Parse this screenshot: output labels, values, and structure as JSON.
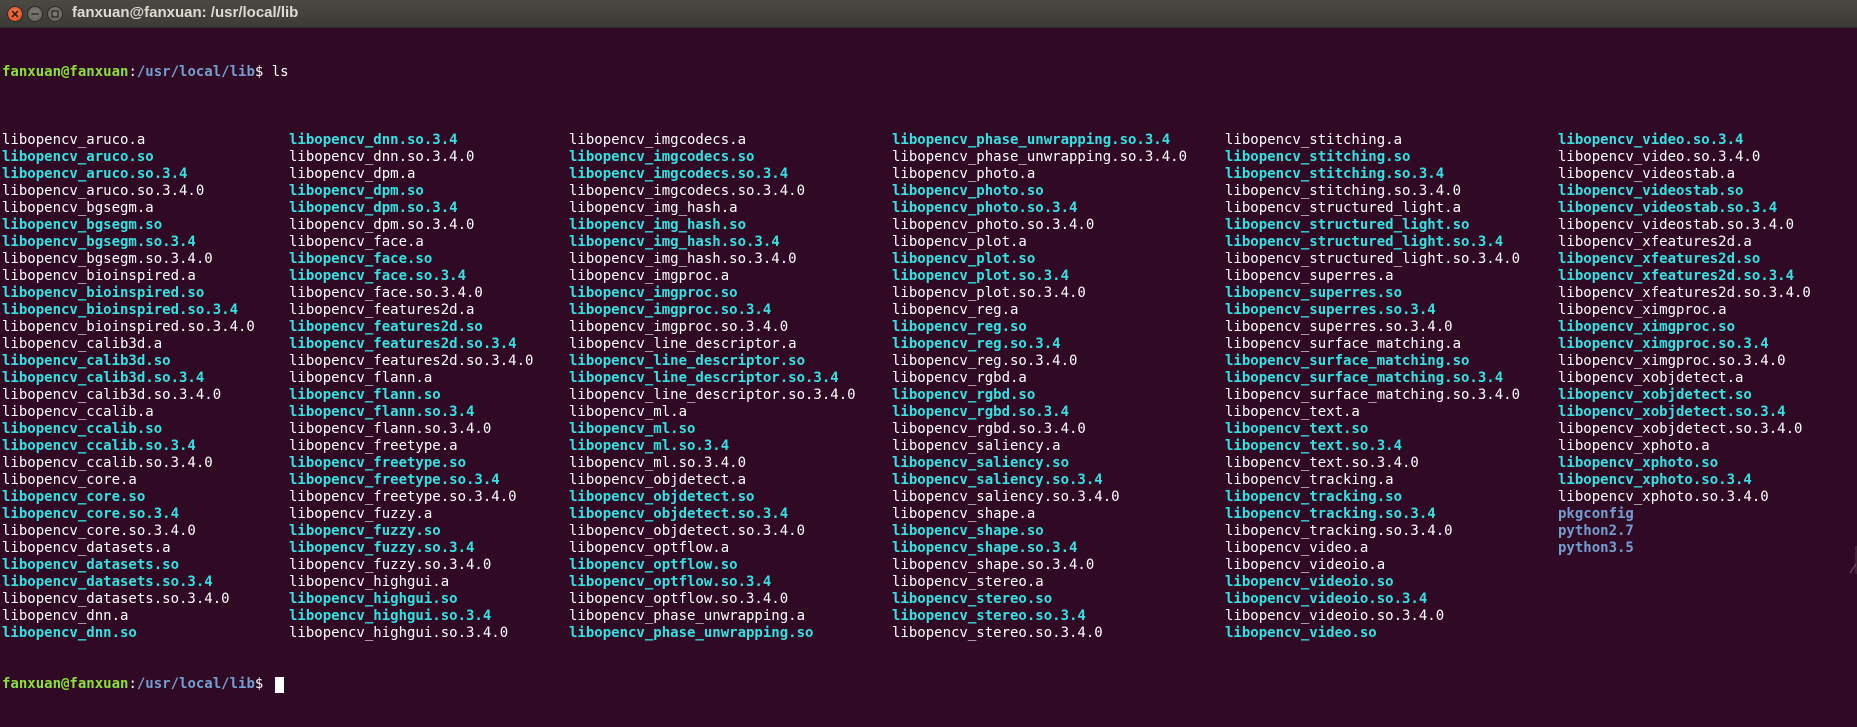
{
  "window": {
    "title": "fanxuan@fanxuan: /usr/local/lib"
  },
  "prompt": {
    "user_host": "fanxuan@fanxuan",
    "colon": ":",
    "path": "/usr/local/lib",
    "dollar": "$ "
  },
  "command": "ls",
  "colors": {
    "background": "#300a24",
    "file": "#ffffff",
    "symlink": "#34e2e2",
    "directory": "#729fcf",
    "prompt_user": "#8ae234"
  },
  "listing": [
    [
      {
        "name": "libopencv_aruco.a",
        "type": "file"
      },
      {
        "name": "libopencv_aruco.so",
        "type": "link"
      },
      {
        "name": "libopencv_aruco.so.3.4",
        "type": "link"
      },
      {
        "name": "libopencv_aruco.so.3.4.0",
        "type": "file"
      },
      {
        "name": "libopencv_bgsegm.a",
        "type": "file"
      },
      {
        "name": "libopencv_bgsegm.so",
        "type": "link"
      },
      {
        "name": "libopencv_bgsegm.so.3.4",
        "type": "link"
      },
      {
        "name": "libopencv_bgsegm.so.3.4.0",
        "type": "file"
      },
      {
        "name": "libopencv_bioinspired.a",
        "type": "file"
      },
      {
        "name": "libopencv_bioinspired.so",
        "type": "link"
      },
      {
        "name": "libopencv_bioinspired.so.3.4",
        "type": "link"
      },
      {
        "name": "libopencv_bioinspired.so.3.4.0",
        "type": "file"
      },
      {
        "name": "libopencv_calib3d.a",
        "type": "file"
      },
      {
        "name": "libopencv_calib3d.so",
        "type": "link"
      },
      {
        "name": "libopencv_calib3d.so.3.4",
        "type": "link"
      },
      {
        "name": "libopencv_calib3d.so.3.4.0",
        "type": "file"
      },
      {
        "name": "libopencv_ccalib.a",
        "type": "file"
      },
      {
        "name": "libopencv_ccalib.so",
        "type": "link"
      },
      {
        "name": "libopencv_ccalib.so.3.4",
        "type": "link"
      },
      {
        "name": "libopencv_ccalib.so.3.4.0",
        "type": "file"
      },
      {
        "name": "libopencv_core.a",
        "type": "file"
      },
      {
        "name": "libopencv_core.so",
        "type": "link"
      },
      {
        "name": "libopencv_core.so.3.4",
        "type": "link"
      },
      {
        "name": "libopencv_core.so.3.4.0",
        "type": "file"
      },
      {
        "name": "libopencv_datasets.a",
        "type": "file"
      },
      {
        "name": "libopencv_datasets.so",
        "type": "link"
      },
      {
        "name": "libopencv_datasets.so.3.4",
        "type": "link"
      },
      {
        "name": "libopencv_datasets.so.3.4.0",
        "type": "file"
      },
      {
        "name": "libopencv_dnn.a",
        "type": "file"
      },
      {
        "name": "libopencv_dnn.so",
        "type": "link"
      }
    ],
    [
      {
        "name": "libopencv_dnn.so.3.4",
        "type": "link"
      },
      {
        "name": "libopencv_dnn.so.3.4.0",
        "type": "file"
      },
      {
        "name": "libopencv_dpm.a",
        "type": "file"
      },
      {
        "name": "libopencv_dpm.so",
        "type": "link"
      },
      {
        "name": "libopencv_dpm.so.3.4",
        "type": "link"
      },
      {
        "name": "libopencv_dpm.so.3.4.0",
        "type": "file"
      },
      {
        "name": "libopencv_face.a",
        "type": "file"
      },
      {
        "name": "libopencv_face.so",
        "type": "link"
      },
      {
        "name": "libopencv_face.so.3.4",
        "type": "link"
      },
      {
        "name": "libopencv_face.so.3.4.0",
        "type": "file"
      },
      {
        "name": "libopencv_features2d.a",
        "type": "file"
      },
      {
        "name": "libopencv_features2d.so",
        "type": "link"
      },
      {
        "name": "libopencv_features2d.so.3.4",
        "type": "link"
      },
      {
        "name": "libopencv_features2d.so.3.4.0",
        "type": "file"
      },
      {
        "name": "libopencv_flann.a",
        "type": "file"
      },
      {
        "name": "libopencv_flann.so",
        "type": "link"
      },
      {
        "name": "libopencv_flann.so.3.4",
        "type": "link"
      },
      {
        "name": "libopencv_flann.so.3.4.0",
        "type": "file"
      },
      {
        "name": "libopencv_freetype.a",
        "type": "file"
      },
      {
        "name": "libopencv_freetype.so",
        "type": "link"
      },
      {
        "name": "libopencv_freetype.so.3.4",
        "type": "link"
      },
      {
        "name": "libopencv_freetype.so.3.4.0",
        "type": "file"
      },
      {
        "name": "libopencv_fuzzy.a",
        "type": "file"
      },
      {
        "name": "libopencv_fuzzy.so",
        "type": "link"
      },
      {
        "name": "libopencv_fuzzy.so.3.4",
        "type": "link"
      },
      {
        "name": "libopencv_fuzzy.so.3.4.0",
        "type": "file"
      },
      {
        "name": "libopencv_highgui.a",
        "type": "file"
      },
      {
        "name": "libopencv_highgui.so",
        "type": "link"
      },
      {
        "name": "libopencv_highgui.so.3.4",
        "type": "link"
      },
      {
        "name": "libopencv_highgui.so.3.4.0",
        "type": "file"
      }
    ],
    [
      {
        "name": "libopencv_imgcodecs.a",
        "type": "file"
      },
      {
        "name": "libopencv_imgcodecs.so",
        "type": "link"
      },
      {
        "name": "libopencv_imgcodecs.so.3.4",
        "type": "link"
      },
      {
        "name": "libopencv_imgcodecs.so.3.4.0",
        "type": "file"
      },
      {
        "name": "libopencv_img_hash.a",
        "type": "file"
      },
      {
        "name": "libopencv_img_hash.so",
        "type": "link"
      },
      {
        "name": "libopencv_img_hash.so.3.4",
        "type": "link"
      },
      {
        "name": "libopencv_img_hash.so.3.4.0",
        "type": "file"
      },
      {
        "name": "libopencv_imgproc.a",
        "type": "file"
      },
      {
        "name": "libopencv_imgproc.so",
        "type": "link"
      },
      {
        "name": "libopencv_imgproc.so.3.4",
        "type": "link"
      },
      {
        "name": "libopencv_imgproc.so.3.4.0",
        "type": "file"
      },
      {
        "name": "libopencv_line_descriptor.a",
        "type": "file"
      },
      {
        "name": "libopencv_line_descriptor.so",
        "type": "link"
      },
      {
        "name": "libopencv_line_descriptor.so.3.4",
        "type": "link"
      },
      {
        "name": "libopencv_line_descriptor.so.3.4.0",
        "type": "file"
      },
      {
        "name": "libopencv_ml.a",
        "type": "file"
      },
      {
        "name": "libopencv_ml.so",
        "type": "link"
      },
      {
        "name": "libopencv_ml.so.3.4",
        "type": "link"
      },
      {
        "name": "libopencv_ml.so.3.4.0",
        "type": "file"
      },
      {
        "name": "libopencv_objdetect.a",
        "type": "file"
      },
      {
        "name": "libopencv_objdetect.so",
        "type": "link"
      },
      {
        "name": "libopencv_objdetect.so.3.4",
        "type": "link"
      },
      {
        "name": "libopencv_objdetect.so.3.4.0",
        "type": "file"
      },
      {
        "name": "libopencv_optflow.a",
        "type": "file"
      },
      {
        "name": "libopencv_optflow.so",
        "type": "link"
      },
      {
        "name": "libopencv_optflow.so.3.4",
        "type": "link"
      },
      {
        "name": "libopencv_optflow.so.3.4.0",
        "type": "file"
      },
      {
        "name": "libopencv_phase_unwrapping.a",
        "type": "file"
      },
      {
        "name": "libopencv_phase_unwrapping.so",
        "type": "link"
      }
    ],
    [
      {
        "name": "libopencv_phase_unwrapping.so.3.4",
        "type": "link"
      },
      {
        "name": "libopencv_phase_unwrapping.so.3.4.0",
        "type": "file"
      },
      {
        "name": "libopencv_photo.a",
        "type": "file"
      },
      {
        "name": "libopencv_photo.so",
        "type": "link"
      },
      {
        "name": "libopencv_photo.so.3.4",
        "type": "link"
      },
      {
        "name": "libopencv_photo.so.3.4.0",
        "type": "file"
      },
      {
        "name": "libopencv_plot.a",
        "type": "file"
      },
      {
        "name": "libopencv_plot.so",
        "type": "link"
      },
      {
        "name": "libopencv_plot.so.3.4",
        "type": "link"
      },
      {
        "name": "libopencv_plot.so.3.4.0",
        "type": "file"
      },
      {
        "name": "libopencv_reg.a",
        "type": "file"
      },
      {
        "name": "libopencv_reg.so",
        "type": "link"
      },
      {
        "name": "libopencv_reg.so.3.4",
        "type": "link"
      },
      {
        "name": "libopencv_reg.so.3.4.0",
        "type": "file"
      },
      {
        "name": "libopencv_rgbd.a",
        "type": "file"
      },
      {
        "name": "libopencv_rgbd.so",
        "type": "link"
      },
      {
        "name": "libopencv_rgbd.so.3.4",
        "type": "link"
      },
      {
        "name": "libopencv_rgbd.so.3.4.0",
        "type": "file"
      },
      {
        "name": "libopencv_saliency.a",
        "type": "file"
      },
      {
        "name": "libopencv_saliency.so",
        "type": "link"
      },
      {
        "name": "libopencv_saliency.so.3.4",
        "type": "link"
      },
      {
        "name": "libopencv_saliency.so.3.4.0",
        "type": "file"
      },
      {
        "name": "libopencv_shape.a",
        "type": "file"
      },
      {
        "name": "libopencv_shape.so",
        "type": "link"
      },
      {
        "name": "libopencv_shape.so.3.4",
        "type": "link"
      },
      {
        "name": "libopencv_shape.so.3.4.0",
        "type": "file"
      },
      {
        "name": "libopencv_stereo.a",
        "type": "file"
      },
      {
        "name": "libopencv_stereo.so",
        "type": "link"
      },
      {
        "name": "libopencv_stereo.so.3.4",
        "type": "link"
      },
      {
        "name": "libopencv_stereo.so.3.4.0",
        "type": "file"
      }
    ],
    [
      {
        "name": "libopencv_stitching.a",
        "type": "file"
      },
      {
        "name": "libopencv_stitching.so",
        "type": "link"
      },
      {
        "name": "libopencv_stitching.so.3.4",
        "type": "link"
      },
      {
        "name": "libopencv_stitching.so.3.4.0",
        "type": "file"
      },
      {
        "name": "libopencv_structured_light.a",
        "type": "file"
      },
      {
        "name": "libopencv_structured_light.so",
        "type": "link"
      },
      {
        "name": "libopencv_structured_light.so.3.4",
        "type": "link"
      },
      {
        "name": "libopencv_structured_light.so.3.4.0",
        "type": "file"
      },
      {
        "name": "libopencv_superres.a",
        "type": "file"
      },
      {
        "name": "libopencv_superres.so",
        "type": "link"
      },
      {
        "name": "libopencv_superres.so.3.4",
        "type": "link"
      },
      {
        "name": "libopencv_superres.so.3.4.0",
        "type": "file"
      },
      {
        "name": "libopencv_surface_matching.a",
        "type": "file"
      },
      {
        "name": "libopencv_surface_matching.so",
        "type": "link"
      },
      {
        "name": "libopencv_surface_matching.so.3.4",
        "type": "link"
      },
      {
        "name": "libopencv_surface_matching.so.3.4.0",
        "type": "file"
      },
      {
        "name": "libopencv_text.a",
        "type": "file"
      },
      {
        "name": "libopencv_text.so",
        "type": "link"
      },
      {
        "name": "libopencv_text.so.3.4",
        "type": "link"
      },
      {
        "name": "libopencv_text.so.3.4.0",
        "type": "file"
      },
      {
        "name": "libopencv_tracking.a",
        "type": "file"
      },
      {
        "name": "libopencv_tracking.so",
        "type": "link"
      },
      {
        "name": "libopencv_tracking.so.3.4",
        "type": "link"
      },
      {
        "name": "libopencv_tracking.so.3.4.0",
        "type": "file"
      },
      {
        "name": "libopencv_video.a",
        "type": "file"
      },
      {
        "name": "libopencv_videoio.a",
        "type": "file"
      },
      {
        "name": "libopencv_videoio.so",
        "type": "link"
      },
      {
        "name": "libopencv_videoio.so.3.4",
        "type": "link"
      },
      {
        "name": "libopencv_videoio.so.3.4.0",
        "type": "file"
      },
      {
        "name": "libopencv_video.so",
        "type": "link"
      }
    ],
    [
      {
        "name": "libopencv_video.so.3.4",
        "type": "link"
      },
      {
        "name": "libopencv_video.so.3.4.0",
        "type": "file"
      },
      {
        "name": "libopencv_videostab.a",
        "type": "file"
      },
      {
        "name": "libopencv_videostab.so",
        "type": "link"
      },
      {
        "name": "libopencv_videostab.so.3.4",
        "type": "link"
      },
      {
        "name": "libopencv_videostab.so.3.4.0",
        "type": "file"
      },
      {
        "name": "libopencv_xfeatures2d.a",
        "type": "file"
      },
      {
        "name": "libopencv_xfeatures2d.so",
        "type": "link"
      },
      {
        "name": "libopencv_xfeatures2d.so.3.4",
        "type": "link"
      },
      {
        "name": "libopencv_xfeatures2d.so.3.4.0",
        "type": "file"
      },
      {
        "name": "libopencv_ximgproc.a",
        "type": "file"
      },
      {
        "name": "libopencv_ximgproc.so",
        "type": "link"
      },
      {
        "name": "libopencv_ximgproc.so.3.4",
        "type": "link"
      },
      {
        "name": "libopencv_ximgproc.so.3.4.0",
        "type": "file"
      },
      {
        "name": "libopencv_xobjdetect.a",
        "type": "file"
      },
      {
        "name": "libopencv_xobjdetect.so",
        "type": "link"
      },
      {
        "name": "libopencv_xobjdetect.so.3.4",
        "type": "link"
      },
      {
        "name": "libopencv_xobjdetect.so.3.4.0",
        "type": "file"
      },
      {
        "name": "libopencv_xphoto.a",
        "type": "file"
      },
      {
        "name": "libopencv_xphoto.so",
        "type": "link"
      },
      {
        "name": "libopencv_xphoto.so.3.4",
        "type": "link"
      },
      {
        "name": "libopencv_xphoto.so.3.4.0",
        "type": "file"
      },
      {
        "name": "pkgconfig",
        "type": "dir"
      },
      {
        "name": "python2.7",
        "type": "dir"
      },
      {
        "name": "python3.5",
        "type": "dir"
      }
    ]
  ]
}
